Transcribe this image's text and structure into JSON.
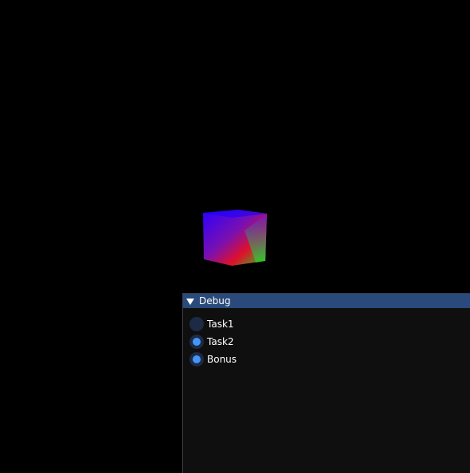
{
  "scene": {
    "object": "cube-icon"
  },
  "debug_window": {
    "title": "Debug",
    "options": [
      {
        "label": "Task1",
        "selected": false
      },
      {
        "label": "Task2",
        "selected": true
      },
      {
        "label": "Bonus",
        "selected": true
      }
    ]
  },
  "colors": {
    "background": "#000000",
    "title_bar": "#294a7a",
    "window_bg": "#0f0f0f",
    "radio_bg": "#1d2a44",
    "radio_selected": "#4296fa"
  }
}
